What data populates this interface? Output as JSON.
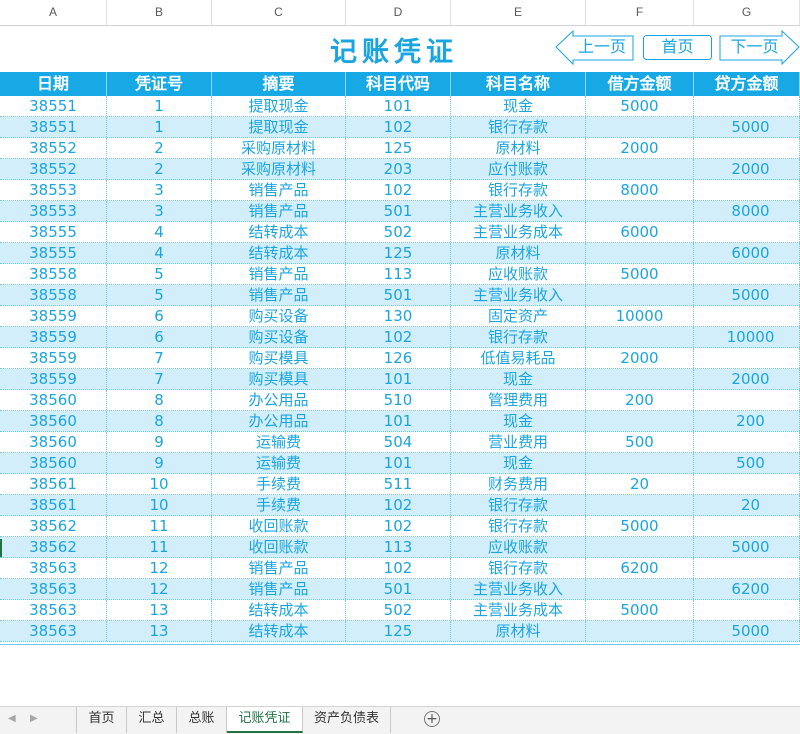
{
  "columns": [
    "A",
    "B",
    "C",
    "D",
    "E",
    "F",
    "G"
  ],
  "title": "记账凭证",
  "nav": {
    "prev": "上一页",
    "home": "首页",
    "next": "下一页"
  },
  "headers": [
    "日期",
    "凭证号",
    "摘要",
    "科目代码",
    "科目名称",
    "借方金额",
    "贷方金额"
  ],
  "rows": [
    [
      "38551",
      "1",
      "提取现金",
      "101",
      "现金",
      "5000",
      ""
    ],
    [
      "38551",
      "1",
      "提取现金",
      "102",
      "银行存款",
      "",
      "5000"
    ],
    [
      "38552",
      "2",
      "采购原材料",
      "125",
      "原材料",
      "2000",
      ""
    ],
    [
      "38552",
      "2",
      "采购原材料",
      "203",
      "应付账款",
      "",
      "2000"
    ],
    [
      "38553",
      "3",
      "销售产品",
      "102",
      "银行存款",
      "8000",
      ""
    ],
    [
      "38553",
      "3",
      "销售产品",
      "501",
      "主营业务收入",
      "",
      "8000"
    ],
    [
      "38555",
      "4",
      "结转成本",
      "502",
      "主营业务成本",
      "6000",
      ""
    ],
    [
      "38555",
      "4",
      "结转成本",
      "125",
      "原材料",
      "",
      "6000"
    ],
    [
      "38558",
      "5",
      "销售产品",
      "113",
      "应收账款",
      "5000",
      ""
    ],
    [
      "38558",
      "5",
      "销售产品",
      "501",
      "主营业务收入",
      "",
      "5000"
    ],
    [
      "38559",
      "6",
      "购买设备",
      "130",
      "固定资产",
      "10000",
      ""
    ],
    [
      "38559",
      "6",
      "购买设备",
      "102",
      "银行存款",
      "",
      "10000"
    ],
    [
      "38559",
      "7",
      "购买模具",
      "126",
      "低值易耗品",
      "2000",
      ""
    ],
    [
      "38559",
      "7",
      "购买模具",
      "101",
      "现金",
      "",
      "2000"
    ],
    [
      "38560",
      "8",
      "办公用品",
      "510",
      "管理费用",
      "200",
      ""
    ],
    [
      "38560",
      "8",
      "办公用品",
      "101",
      "现金",
      "",
      "200"
    ],
    [
      "38560",
      "9",
      "运输费",
      "504",
      "营业费用",
      "500",
      ""
    ],
    [
      "38560",
      "9",
      "运输费",
      "101",
      "现金",
      "",
      "500"
    ],
    [
      "38561",
      "10",
      "手续费",
      "511",
      "财务费用",
      "20",
      ""
    ],
    [
      "38561",
      "10",
      "手续费",
      "102",
      "银行存款",
      "",
      "20"
    ],
    [
      "38562",
      "11",
      "收回账款",
      "102",
      "银行存款",
      "5000",
      ""
    ],
    [
      "38562",
      "11",
      "收回账款",
      "113",
      "应收账款",
      "",
      "5000"
    ],
    [
      "38563",
      "12",
      "销售产品",
      "102",
      "银行存款",
      "6200",
      ""
    ],
    [
      "38563",
      "12",
      "销售产品",
      "501",
      "主营业务收入",
      "",
      "6200"
    ],
    [
      "38563",
      "13",
      "结转成本",
      "502",
      "主营业务成本",
      "5000",
      ""
    ],
    [
      "38563",
      "13",
      "结转成本",
      "125",
      "原材料",
      "",
      "5000"
    ]
  ],
  "sheet_tabs": [
    {
      "label": "首页",
      "active": false
    },
    {
      "label": "汇总",
      "active": false
    },
    {
      "label": "总账",
      "active": false
    },
    {
      "label": "记账凭证",
      "active": true
    },
    {
      "label": "资产负债表",
      "active": false
    }
  ],
  "colors": {
    "accent": "#17a8e6",
    "text": "#1aa5e0",
    "stripe": "#d3eefb",
    "active_tab": "#217346"
  }
}
